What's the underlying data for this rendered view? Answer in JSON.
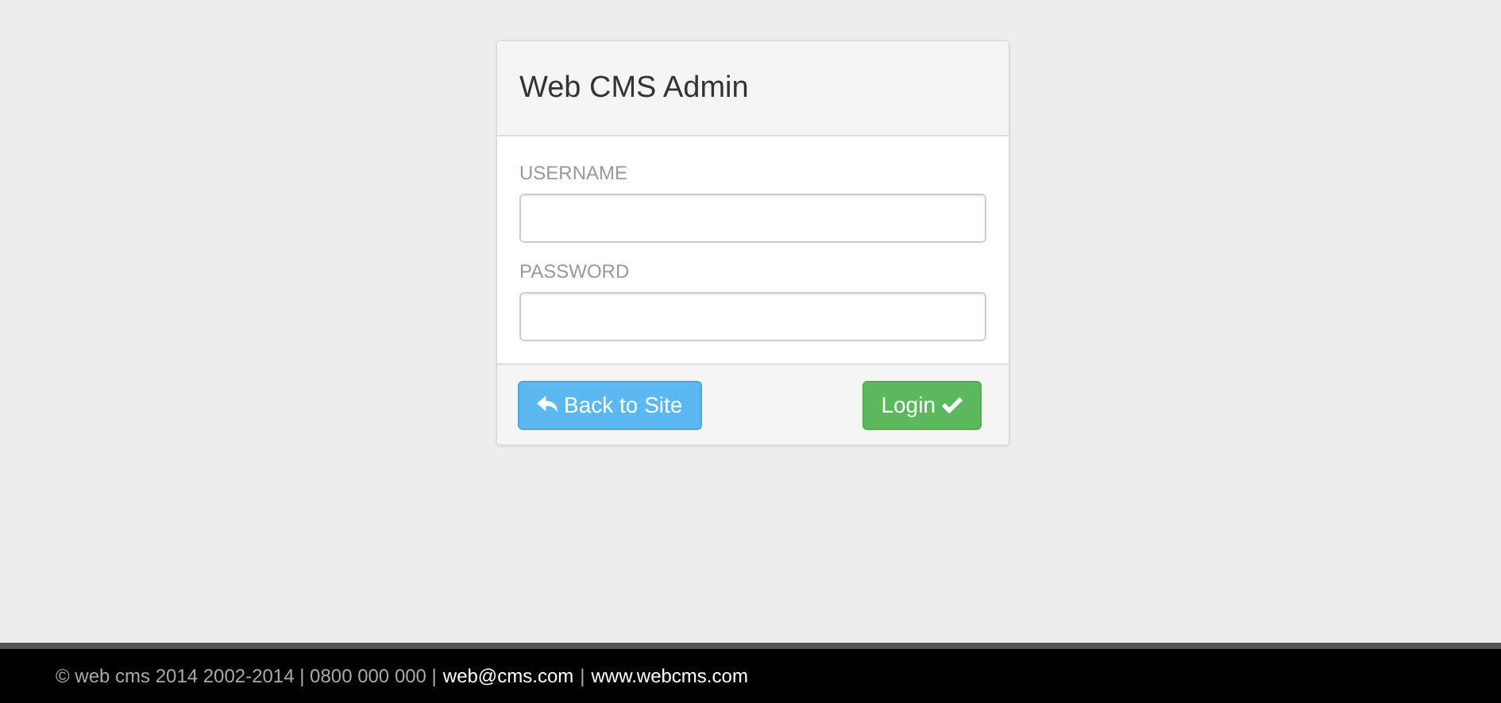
{
  "panel": {
    "title": "Web CMS Admin"
  },
  "fields": [
    {
      "label": "USERNAME"
    },
    {
      "label": "PASSWORD"
    }
  ],
  "buttons": [
    {
      "label": "Back to Site",
      "kind": "back"
    },
    {
      "label": "Login",
      "kind": "login"
    }
  ],
  "footer": {
    "text": "© web cms 2014 2002-2014 | 0800 000 000 |",
    "email": "web@cms.com",
    "separator": "|",
    "website": "www.webcms.com"
  }
}
